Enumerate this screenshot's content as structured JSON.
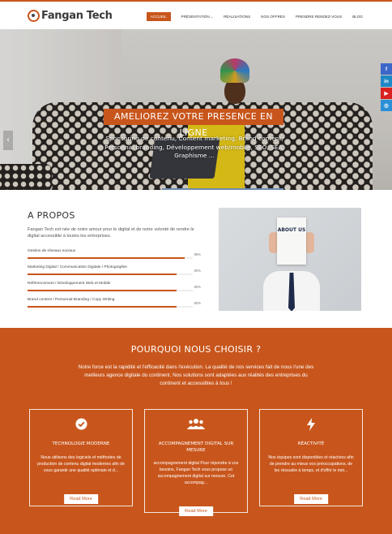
{
  "header": {
    "brand": "Fangan Tech",
    "nav": [
      {
        "label": "ACCUEIL",
        "active": true
      },
      {
        "label": "PRÉSENTATION",
        "dropdown": true
      },
      {
        "label": "RÉALISATIONS"
      },
      {
        "label": "NOS OFFRES"
      },
      {
        "label": "PRENDRE RENDEZ-VOUS"
      },
      {
        "label": "BLOG"
      }
    ],
    "caret": "⌄"
  },
  "hero": {
    "title": "AMELIOREZ VOTRE PRESENCE EN LIGNE",
    "subtitle": "Sponsoring de contenu, Content marketing, Brand content, Personnal branding, Développement web/mobile, SEO, SEA, Graphisme ...",
    "prev_arrow": "‹"
  },
  "social": {
    "items": [
      {
        "name": "facebook-icon",
        "glyph": "f",
        "color": "#3b67c9"
      },
      {
        "name": "linkedin-icon",
        "glyph": "in",
        "color": "#1e88c6"
      },
      {
        "name": "youtube-icon",
        "glyph": "▶",
        "color": "#d92121"
      },
      {
        "name": "instagram-icon",
        "glyph": "◎",
        "color": "#2a8fd6"
      }
    ]
  },
  "about": {
    "title": "A PROPOS",
    "text": "Fangan Tech est née de notre amour pour le digital et de notre volonté de rendre le digital accessible à toutes les entreprises.",
    "photo_text": "ABOUT US",
    "skills": [
      {
        "label": "Gestion de réseaux sociaux",
        "percent": 95,
        "percent_label": "95%"
      },
      {
        "label": "Marketing Digital / Communication Digitale / Photographie",
        "percent": 90,
        "percent_label": "90%"
      },
      {
        "label": "Référencement / Développement Web et Mobile",
        "percent": 90,
        "percent_label": "90%"
      },
      {
        "label": "Brand content / Personnal Branding / Copy Writing",
        "percent": 90,
        "percent_label": "90%"
      }
    ]
  },
  "why": {
    "title": "POURQUOI NOUS CHOISIR ?",
    "text": "Notre force est la rapidité et l'efficacité dans l'exécution. La qualité de nos services fait de nous l'une des meilleurs agence digitale du continent. Nos solutions sont adaptées aux réalités des entreprises du continent et accessibles à tous !",
    "cards": [
      {
        "title": "TECHNOLOGIE MODERNE",
        "text": "Nous utilisons des logiciels et méthodes de production de contenu digital modernes afin de vous garantir une qualité optimale et d...",
        "button": "Read More"
      },
      {
        "title": "ACCOMPAGNEMENT DIGITAL SUR MESURE",
        "text": "accompagnement digital Pour répondre à vos besoins, Fangan Tech vous propose un accompagnement digital sur mesure. Cet accompag...",
        "button": "Read More"
      },
      {
        "title": "RÉACTIVITÉ",
        "text": "Nos équipes sont disponibles et réactives afin de prendre au mieux vos préoccupations, de les résoudre à temps, et d'offrir le mei...",
        "button": "Read More"
      }
    ]
  },
  "colors": {
    "accent": "#c8561c",
    "text": "#333333"
  }
}
